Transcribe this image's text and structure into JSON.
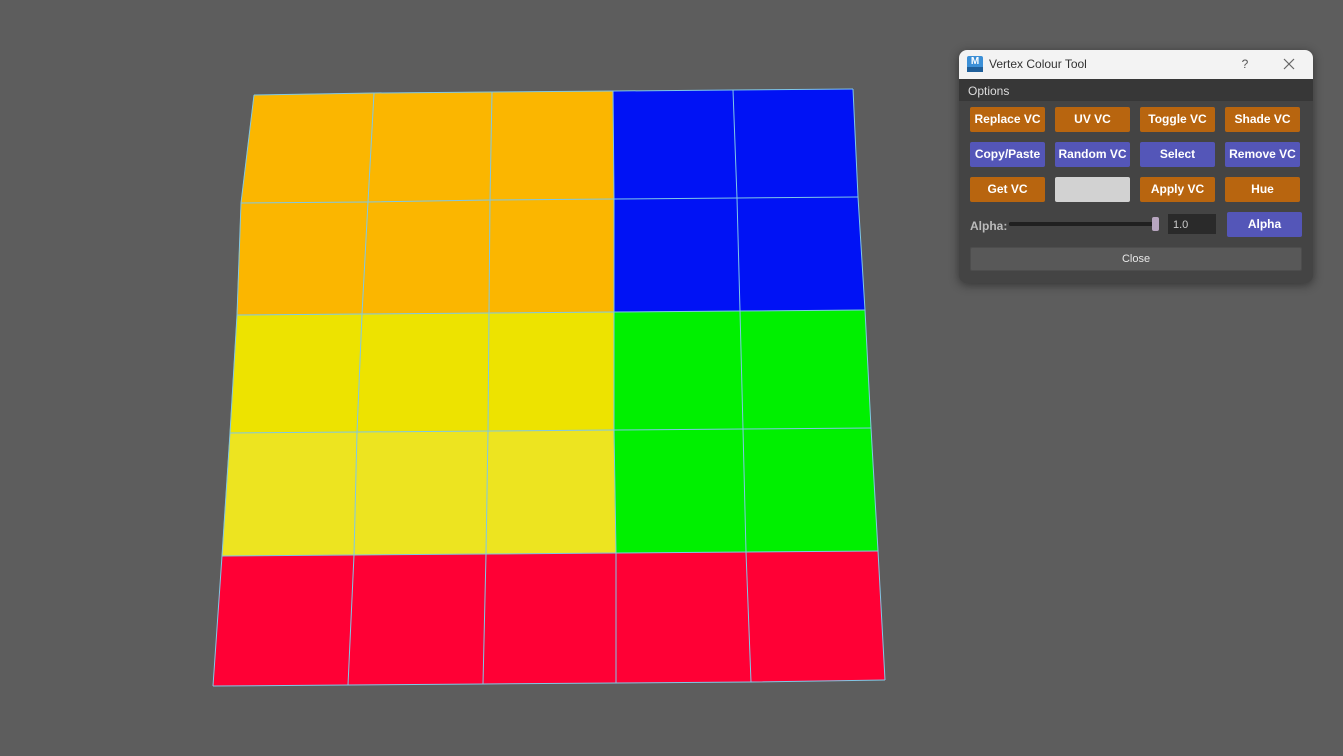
{
  "window": {
    "title": "Vertex Colour Tool",
    "icon_letter": "M",
    "help_label": "?",
    "close_icon": "close-icon"
  },
  "menu": {
    "items": [
      "Options"
    ]
  },
  "buttons": {
    "replace_vc": "Replace VC",
    "uv_vc": "UV VC",
    "toggle_vc": "Toggle VC",
    "shade_vc": "Shade VC",
    "copy_paste": "Copy/Paste",
    "random_vc": "Random VC",
    "select": "Select",
    "remove_vc": "Remove VC",
    "get_vc": "Get VC",
    "colour_swatch": "",
    "apply_vc": "Apply VC",
    "hue": "Hue",
    "alpha": "Alpha",
    "close": "Close"
  },
  "alpha": {
    "label": "Alpha:",
    "value": "1.0",
    "slider_fraction": 1.0
  },
  "swatch_color": "#d2d2d2",
  "colors": {
    "orange_button": "#b8650f",
    "purple_button": "#5456b8",
    "viewport_bg": "#5d5d5d",
    "edge": "#7fc8e6"
  },
  "mesh": {
    "rows": 5,
    "cols": 5,
    "face_colors": [
      [
        "#fbb600",
        "#fbb600",
        "#fbb600",
        "#0012f5",
        "#0012f5"
      ],
      [
        "#fbb600",
        "#fbb600",
        "#fbb600",
        "#0012f5",
        "#0012f5"
      ],
      [
        "#ede300",
        "#ede300",
        "#ede300",
        "#00f000",
        "#00f000"
      ],
      [
        "#ede420",
        "#ede420",
        "#ede420",
        "#00f000",
        "#00f000"
      ],
      [
        "#ff0035",
        "#ff0035",
        "#ff0035",
        "#ff0035",
        "#ff0035"
      ]
    ]
  }
}
